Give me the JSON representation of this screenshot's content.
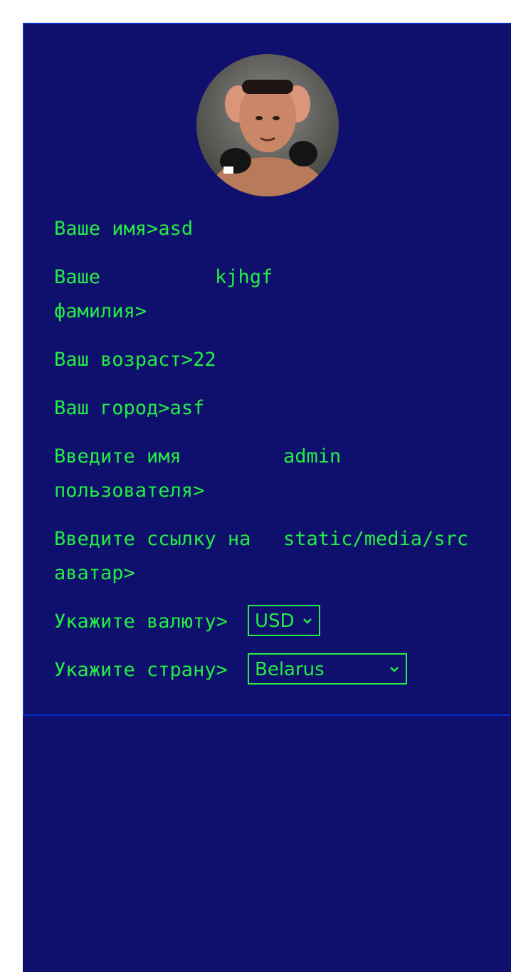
{
  "profile": {
    "first_name_label": "Ваше имя>",
    "first_name_value": "asd",
    "last_name_label": "Ваше\nфамилия>",
    "last_name_value": "kjhgf",
    "age_label": "Ваш возраст>",
    "age_value": "22",
    "city_label": "Ваш город>",
    "city_value": "asf",
    "username_label": "Введите имя\nпользователя>",
    "username_value": "admin",
    "avatar_link_label": "Введите ссылку на\nаватар>",
    "avatar_link_value": "static/media/src",
    "currency_label": "Укажите валюту>",
    "currency_value": "USD",
    "country_label": "Укажите страну>",
    "country_value": "Belarus"
  },
  "colors": {
    "background": "#0f0f6e",
    "text": "#22ee44",
    "border": "#0a2ec8"
  },
  "icons": {
    "avatar": "avatar-image",
    "select_arrow": "chevron-down-icon"
  }
}
